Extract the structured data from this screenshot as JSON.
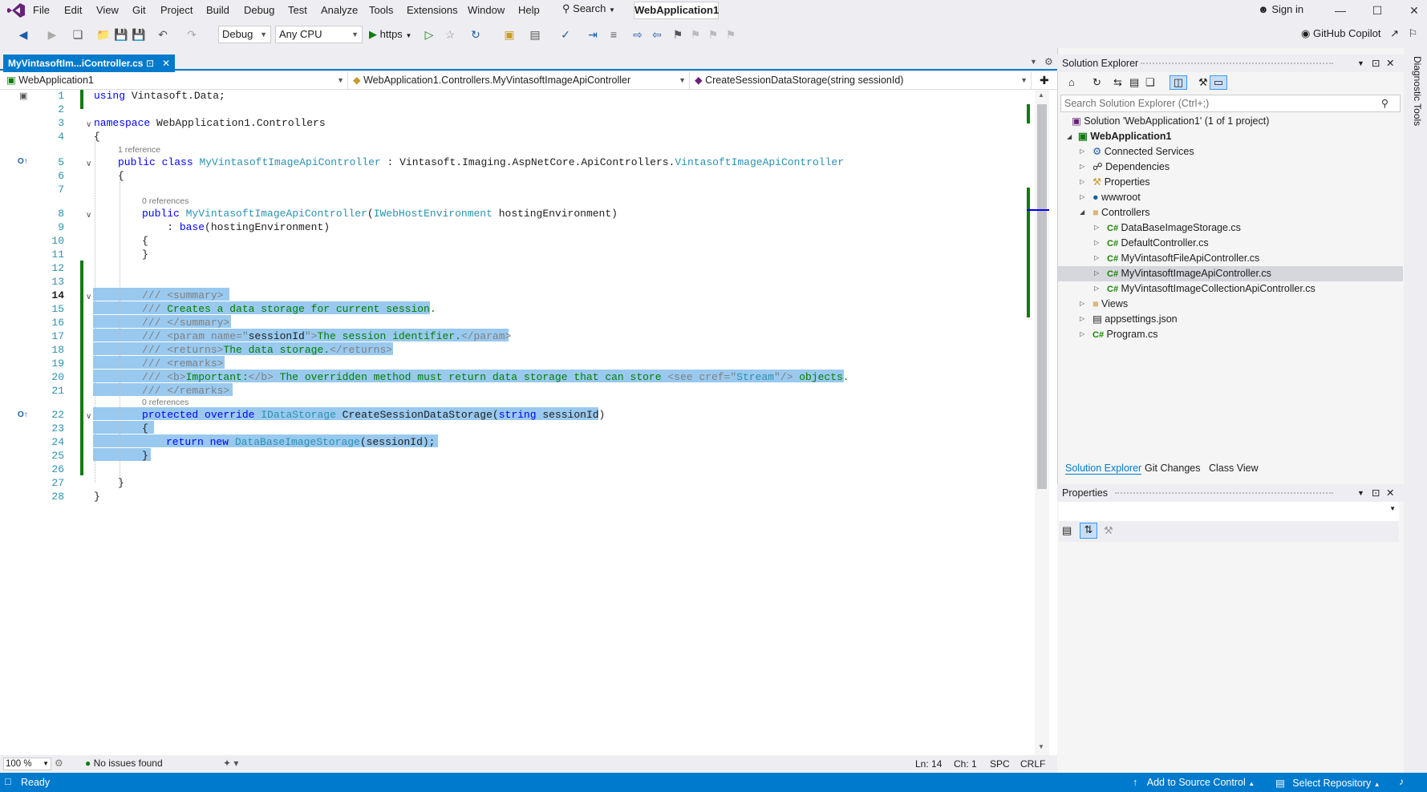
{
  "menu": {
    "items": [
      "File",
      "Edit",
      "View",
      "Git",
      "Project",
      "Build",
      "Debug",
      "Test",
      "Analyze",
      "Tools",
      "Extensions",
      "Window",
      "Help"
    ],
    "search_label": "Search",
    "solution_title": "WebApplication1",
    "sign_in": "Sign in"
  },
  "toolbar": {
    "config": "Debug",
    "platform": "Any CPU",
    "run_label": "https",
    "copilot": "GitHub Copilot"
  },
  "editor": {
    "tab_title": "MyVintasoftIm...iController.cs",
    "nav_project": "WebApplication1",
    "nav_class": "WebApplication1.Controllers.MyVintasoftImageApiController",
    "nav_member": "CreateSessionDataStorage(string sessionId)",
    "lens_1": "1 reference",
    "lens_0a": "0 references",
    "lens_0b": "0 references",
    "lines": {
      "l1_a": "using",
      "l1_b": " Vintasoft.Data;",
      "l3_a": "namespace",
      "l3_b": " WebApplication1.Controllers",
      "l4": "{",
      "l5_a": "public class",
      "l5_b": "MyVintasoftImageApiController",
      "l5_c": " : Vintasoft.Imaging.AspNetCore.ApiControllers.",
      "l5_d": "VintasoftImageApiController",
      "l6": "{",
      "l8_a": "public",
      "l8_b": "MyVintasoftImageApiController",
      "l8_c": "(",
      "l8_d": "IWebHostEnvironment",
      "l8_e": " hostingEnvironment)",
      "l9_a": "    : ",
      "l9_b": "base",
      "l9_c": "(hostingEnvironment)",
      "l10": "{",
      "l11": "}",
      "l14_a": "///",
      "l14_b": " <summary>",
      "l15_a": "///",
      "l15_b": " Creates a data storage for current session.",
      "l16_a": "///",
      "l16_b": " </summary>",
      "l17_a": "///",
      "l17_b": " <param name=\"",
      "l17_c": "sessionId",
      "l17_d": "\">",
      "l17_e": "The session identifier.",
      "l17_f": "</param>",
      "l18_a": "///",
      "l18_b": " <returns>",
      "l18_c": "The data storage.",
      "l18_d": "</returns>",
      "l19_a": "///",
      "l19_b": " <remarks>",
      "l20_a": "///",
      "l20_b": " <b>",
      "l20_c": "Important:",
      "l20_d": "</b>",
      "l20_e": " The overridden method must return data storage that can store ",
      "l20_f": "<see cref=\"",
      "l20_g": "Stream",
      "l20_h": "\"/>",
      "l20_i": " objects.",
      "l21_a": "///",
      "l21_b": " </remarks>",
      "l22_a": "protected override",
      "l22_b": "IDataStorage",
      "l22_c": " CreateSessionDataStorage(",
      "l22_d": "string",
      "l22_e": " sessionId)",
      "l23": "{",
      "l24_a": "return new",
      "l24_b": "DataBaseImageStorage",
      "l24_c": "(sessionId);",
      "l25": "}",
      "l27": "}",
      "l28": "}"
    },
    "line_numbers": [
      "1",
      "2",
      "3",
      "4",
      "5",
      "6",
      "7",
      "8",
      "9",
      "10",
      "11",
      "12",
      "13",
      "14",
      "15",
      "16",
      "17",
      "18",
      "19",
      "20",
      "21",
      "22",
      "23",
      "24",
      "25",
      "26",
      "27",
      "28"
    ],
    "status": {
      "zoom": "100 %",
      "issues": "No issues found",
      "ln": "Ln: 14",
      "ch": "Ch: 1",
      "spc": "SPC",
      "crlf": "CRLF"
    }
  },
  "solution_explorer": {
    "title": "Solution Explorer",
    "search_placeholder": "Search Solution Explorer (Ctrl+;)",
    "solution": "Solution 'WebApplication1' (1 of 1 project)",
    "project": "WebApplication1",
    "items": {
      "connected": "Connected Services",
      "dependencies": "Dependencies",
      "properties": "Properties",
      "wwwroot": "wwwroot",
      "controllers": "Controllers",
      "c1": "DataBaseImageStorage.cs",
      "c2": "DefaultController.cs",
      "c3": "MyVintasoftFileApiController.cs",
      "c4": "MyVintasoftImageApiController.cs",
      "c5": "MyVintasoftImageCollectionApiController.cs",
      "views": "Views",
      "appsettings": "appsettings.json",
      "program": "Program.cs"
    },
    "tabs": [
      "Solution Explorer",
      "Git Changes",
      "Class View"
    ]
  },
  "properties_panel": {
    "title": "Properties"
  },
  "diagnostic_tools": "Diagnostic Tools",
  "statusbar": {
    "ready": "Ready",
    "source_control": "Add to Source Control",
    "repository": "Select Repository"
  },
  "colors": {
    "accent": "#007acc",
    "selection": "#99c9ef",
    "keyword": "#0000ff",
    "type": "#2b91af",
    "comment": "#008000"
  }
}
